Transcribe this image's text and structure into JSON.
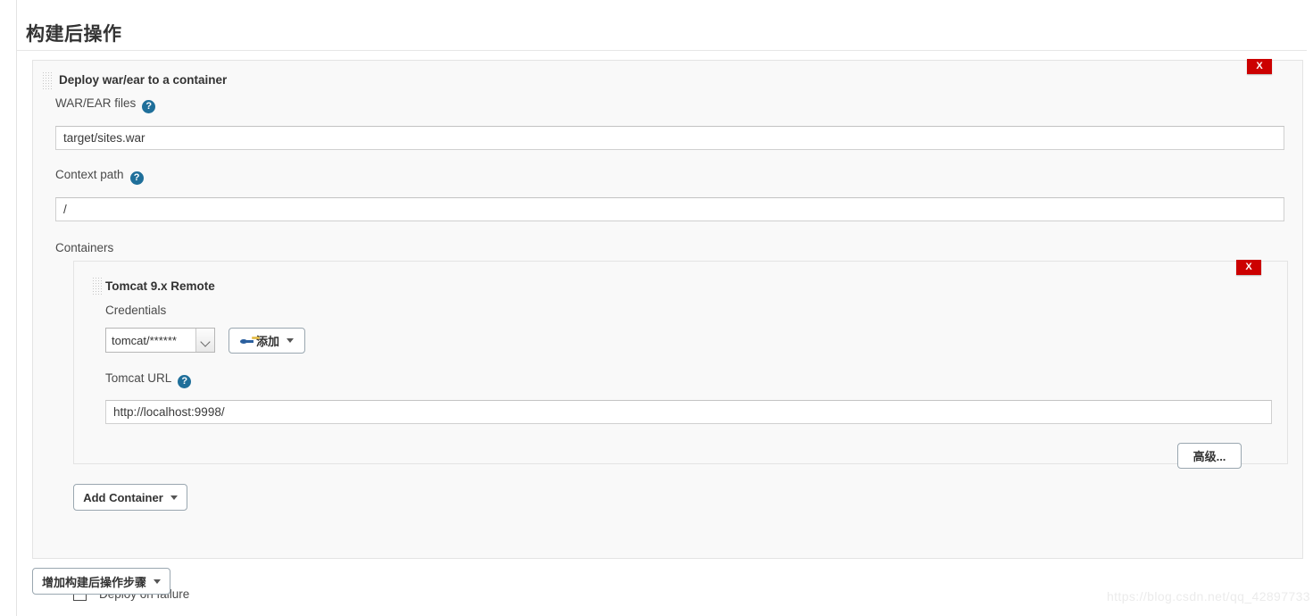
{
  "page": {
    "section_title": "构建后操作",
    "watermark": "https://blog.csdn.net/qq_42897733"
  },
  "publisher": {
    "heading": "Deploy war/ear to a container",
    "delete_label": "X",
    "war_files": {
      "label": "WAR/EAR files",
      "help": "?",
      "value": "target/sites.war"
    },
    "context_path": {
      "label": "Context path",
      "help": "?",
      "value": "/"
    },
    "containers_label": "Containers",
    "container": {
      "heading": "Tomcat 9.x Remote",
      "delete_label": "X",
      "credentials": {
        "label": "Credentials",
        "selected": "tomcat/******",
        "options": [
          "tomcat/******"
        ],
        "add_button": "添加",
        "add_icon": "key-icon"
      },
      "tomcat_url": {
        "label": "Tomcat URL",
        "help": "?",
        "value": "http://localhost:9998/"
      },
      "advanced_button": "高级..."
    },
    "add_container_button": "Add Container",
    "deploy_on_failure": {
      "label": "Deploy on failure",
      "checked": false
    }
  },
  "footer": {
    "add_post_build_step_button": "增加构建后操作步骤"
  }
}
